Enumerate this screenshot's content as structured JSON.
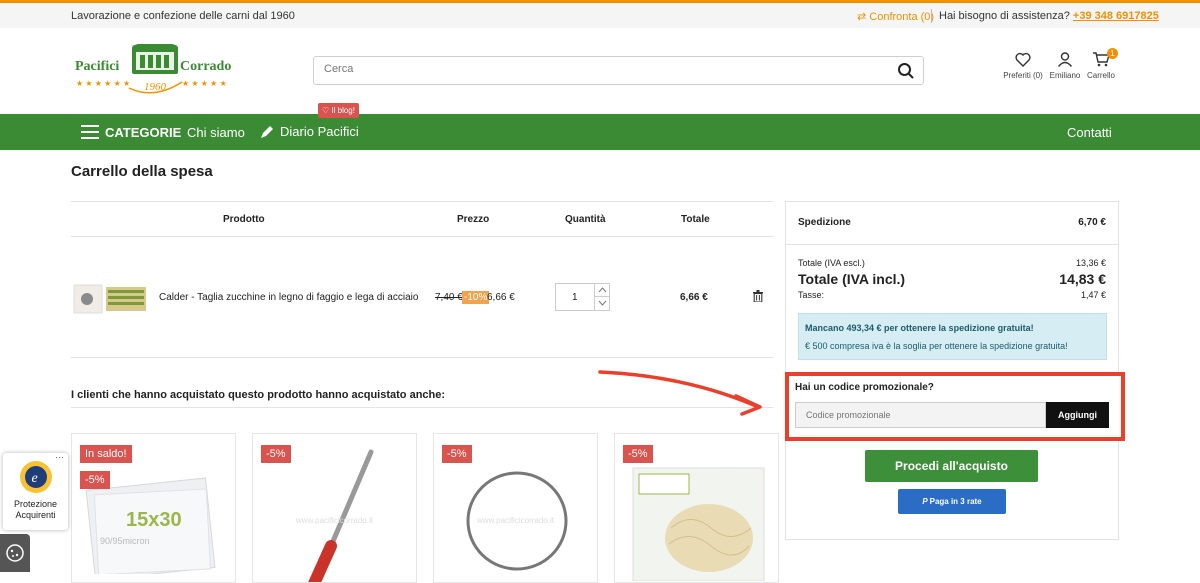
{
  "topbar": {
    "tagline": "Lavorazione e confezione delle carni dal 1960",
    "compare": "Confronta (0)",
    "help_label": "Hai bisogno di assistenza?",
    "phone": "+39 348 6917825"
  },
  "header": {
    "logo_text_left": "Pacifici",
    "logo_text_right": "Corrado",
    "logo_year": "1960",
    "search_placeholder": "Cerca",
    "favorites_label": "Preferiti (0)",
    "account_label": "Emiliano",
    "cart_label": "Carrello",
    "cart_count": "1"
  },
  "nav": {
    "categories": "CATEGORIE",
    "about": "Chi siamo",
    "diary": "Diario Pacifici",
    "blog_tag": "Il blog!",
    "contacts": "Contatti"
  },
  "cart": {
    "title": "Carrello della spesa",
    "headers": {
      "product": "Prodotto",
      "price": "Prezzo",
      "quantity": "Quantità",
      "total": "Totale"
    },
    "items": [
      {
        "name": "Calder - Taglia zucchine in legno di faggio e lega di acciaio",
        "old_price": "7,40 €",
        "discount": "-10%",
        "price": "6,66 €",
        "quantity": "1",
        "total": "6,66 €"
      }
    ]
  },
  "also_bought": {
    "title": "I clienti che hanno acquistato questo prodotto hanno acquistato anche:",
    "products": [
      {
        "badges": [
          "In saldo!",
          "-5%"
        ],
        "caption": "15x30",
        "subcaption": "90/95micron"
      },
      {
        "badges": [
          "-5%"
        ]
      },
      {
        "badges": [
          "-5%"
        ]
      },
      {
        "badges": [
          "-5%"
        ]
      }
    ],
    "watermark": "www.pacificicorrado.it"
  },
  "summary": {
    "shipping_label": "Spedizione",
    "shipping_value": "6,70 €",
    "subtotal_label": "Totale (IVA escl.)",
    "subtotal_value": "13,36 €",
    "total_label": "Totale (IVA incl.)",
    "total_value": "14,83 €",
    "tax_label": "Tasse:",
    "tax_value": "1,47 €",
    "free_ship_msg": "Mancano 493,34 € per ottenere la spedizione gratuita!",
    "free_ship_note": "€ 500 compresa iva è la soglia per ottenere la spedizione gratuita!"
  },
  "promo": {
    "title": "Hai un codice promozionale?",
    "placeholder": "Codice promozionale",
    "button": "Aggiungi"
  },
  "checkout": {
    "proceed": "Procedi all'acquisto",
    "paypal": "Paga in 3 rate"
  },
  "trusted": {
    "label": "Protezione Acquirenti",
    "dots": "···"
  },
  "colors": {
    "accent": "#f29100",
    "nav_green": "#3b8a34",
    "highlight_red": "#e8402a",
    "checkout_green": "#3d8f3a"
  }
}
